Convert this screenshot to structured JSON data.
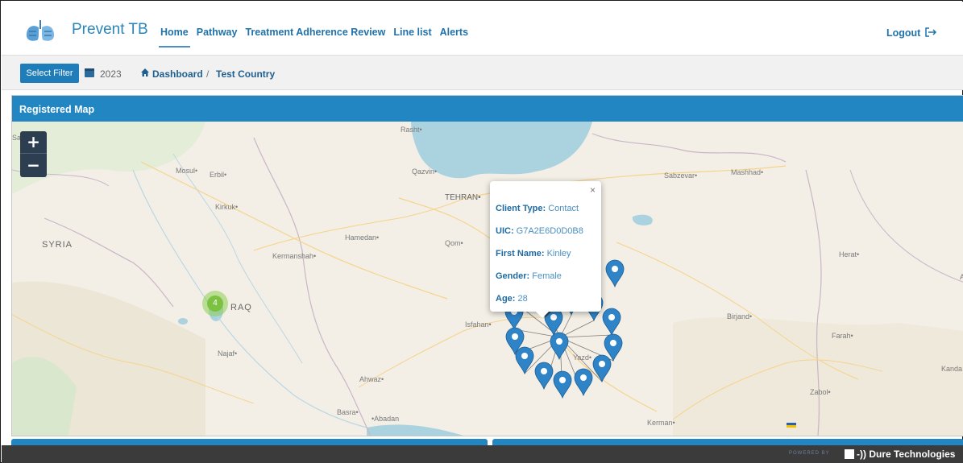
{
  "navbar": {
    "brand": "Prevent TB",
    "items": [
      {
        "label": "Home",
        "active": true
      },
      {
        "label": "Pathway"
      },
      {
        "label": "Treatment Adherence Review"
      },
      {
        "label": "Line list"
      },
      {
        "label": "Alerts"
      }
    ],
    "logout": "Logout",
    "icons": {
      "logo": "lungs-logo-icon",
      "logout": "logout-icon",
      "theme": "moon-icon"
    }
  },
  "filterbar": {
    "select_filter": "Select Filter",
    "year": "2023",
    "breadcrumb": [
      "Dashboard",
      "Test Country"
    ],
    "separator": "/"
  },
  "panel": {
    "title": "Registered Map"
  },
  "map": {
    "zoom_in": "+",
    "zoom_out": "−",
    "cluster_count": "4",
    "labels": {
      "rasht": "Rasht•",
      "mosul": "Mosul•",
      "erbil": "Erbil•",
      "kirkuk": "Kirkuk•",
      "qazvin": "Qazvin•",
      "tehran": "TEHRAN•",
      "sabzevar": "Sabzevar•",
      "mashhad": "Mashhad•",
      "syria": "SYRIA",
      "hamedan": "Hamedan•",
      "qom": "Qom•",
      "kermanshah": "Kermanshah•",
      "herat": "Herat•",
      "iraq": "RAQ",
      "birjand": "Birjand•",
      "isfahan": "Isfahan•",
      "farah": "Farah•",
      "najaf": "Najaf•",
      "yazd": "Yazd•",
      "kanda": "Kanda",
      "ahwaz": "Ahwaz•",
      "zabol": "Zabol•",
      "basra": "Basra•",
      "abadan": "•Abadan",
      "kerman": "Kerman•",
      "edge_sa": "Sa",
      "edge_a": "A"
    },
    "popup": {
      "close": "×",
      "rows": [
        {
          "label": "Client Type:",
          "value": "Contact"
        },
        {
          "label": "UIC:",
          "value": "G7A2E6D0D0B8"
        },
        {
          "label": "First Name:",
          "value": "Kinley"
        },
        {
          "label": "Gender:",
          "value": "Female"
        },
        {
          "label": "Age:",
          "value": "28"
        }
      ]
    },
    "marker_color": "#2f84c8",
    "cluster_color": "#7cc142"
  },
  "footer": {
    "powered_by": "POWERED BY",
    "company": "-)) Dure Technologies"
  },
  "colors": {
    "primary": "#2286c3",
    "nav_text": "#1f72ab",
    "footer_bg": "#3b3b3b"
  }
}
